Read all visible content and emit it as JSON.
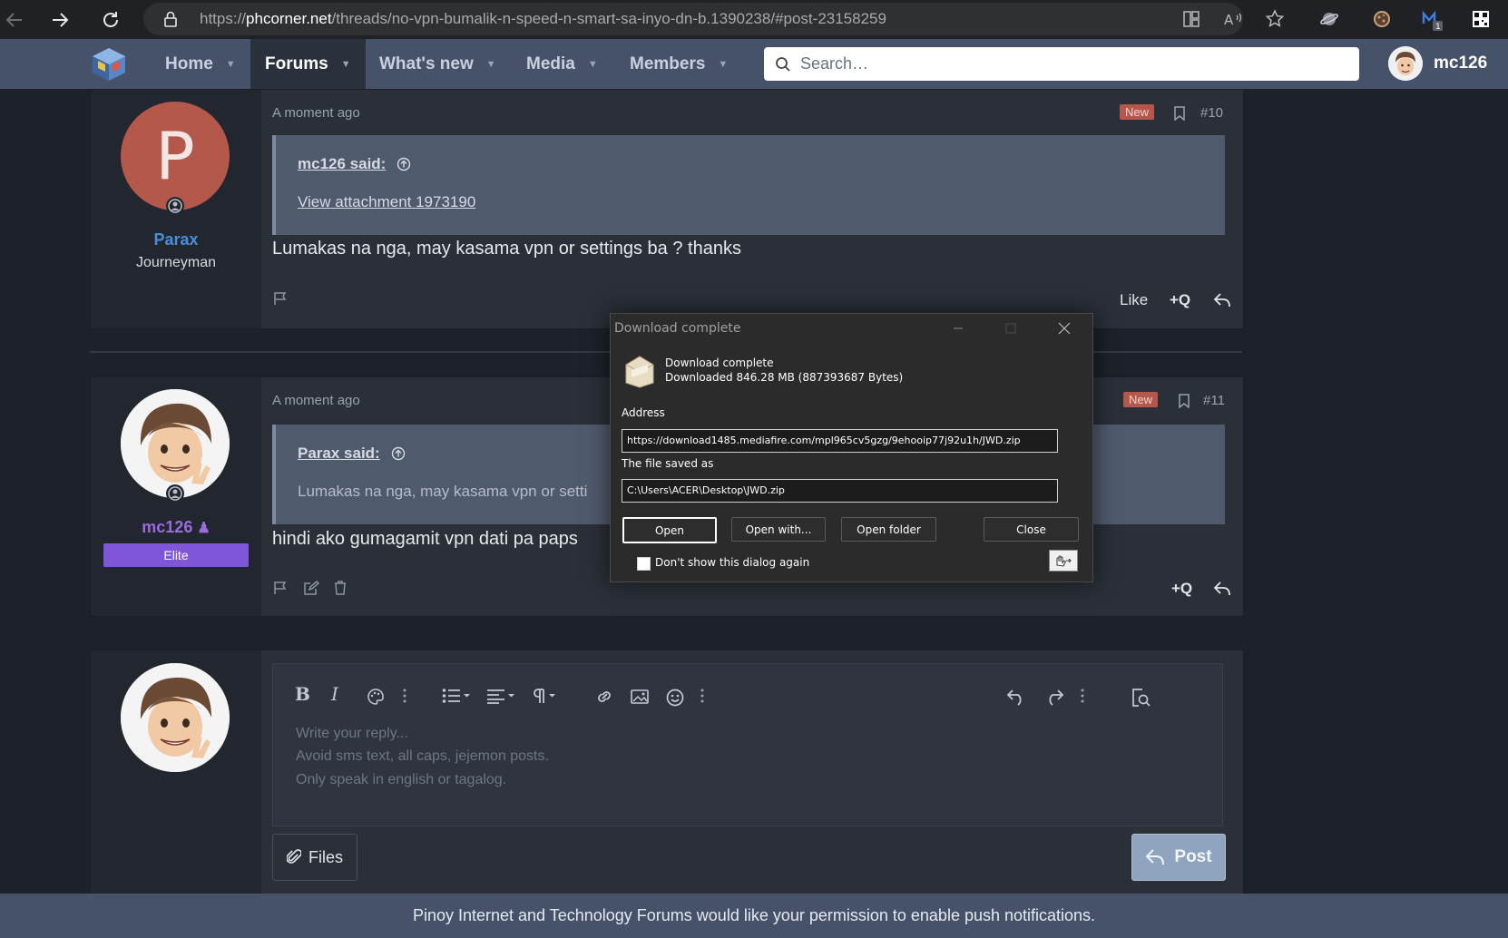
{
  "browser": {
    "url_prefix": "https://",
    "url_host": "phcorner.net",
    "url_path": "/threads/no-vpn-bumalik-n-speed-n-smart-sa-inyo-dn-b.1390238/#post-23158259",
    "notification_count": "1"
  },
  "nav": {
    "items": [
      {
        "label": "Home"
      },
      {
        "label": "Forums"
      },
      {
        "label": "What's new"
      },
      {
        "label": "Media"
      },
      {
        "label": "Members"
      }
    ],
    "search_placeholder": "Search…",
    "username": "mc126"
  },
  "posts": [
    {
      "author": "Parax",
      "avatar_letter": "P",
      "author_title": "Journeyman",
      "time": "A moment ago",
      "badge": "New",
      "number": "#10",
      "quote_author": "mc126 said:",
      "quote_body": "View attachment 1973190",
      "text": "Lumakas na nga, may kasama vpn or settings ba ? thanks",
      "like_label": "Like",
      "quote_label": "+Q"
    },
    {
      "author": "mc126",
      "author_badge": "Elite",
      "time": "A moment ago",
      "badge": "New",
      "number": "#11",
      "quote_author": "Parax said:",
      "quote_body": "Lumakas na nga, may kasama vpn or setti",
      "text": "hindi ako gumagamit vpn dati pa paps",
      "quote_label": "+Q"
    }
  ],
  "reply": {
    "placeholder_lines": [
      "Write your reply...",
      "Avoid sms text, all caps, jejemon posts.",
      "Only speak in english or tagalog."
    ],
    "files_label": "Files",
    "post_label": "Post"
  },
  "push_notice": "Pinoy Internet and Technology Forums would like your permission to enable push notifications.",
  "dialog": {
    "title": "Download complete",
    "heading": "Download complete",
    "size_text": "Downloaded 846.28  MB (887393687 Bytes)",
    "address_label": "Address",
    "address_value": "https://download1485.mediafire.com/mpl965cv5gzg/9ehooip77j92u1h/JWD.zip",
    "saved_label": "The file saved as",
    "saved_value": "C:\\Users\\ACER\\Desktop\\JWD.zip",
    "buttons": {
      "open": "Open",
      "open_with": "Open with...",
      "open_folder": "Open folder",
      "close": "Close"
    },
    "dont_show": "Don't show this dialog again"
  },
  "colors": {
    "nav_bg": "#46526a",
    "page_bg": "#1d2129",
    "author_blue": "#4a8fd6",
    "author_purple": "#9b6be0",
    "elite_badge": "#7f56d9",
    "new_badge": "#b4584c"
  }
}
